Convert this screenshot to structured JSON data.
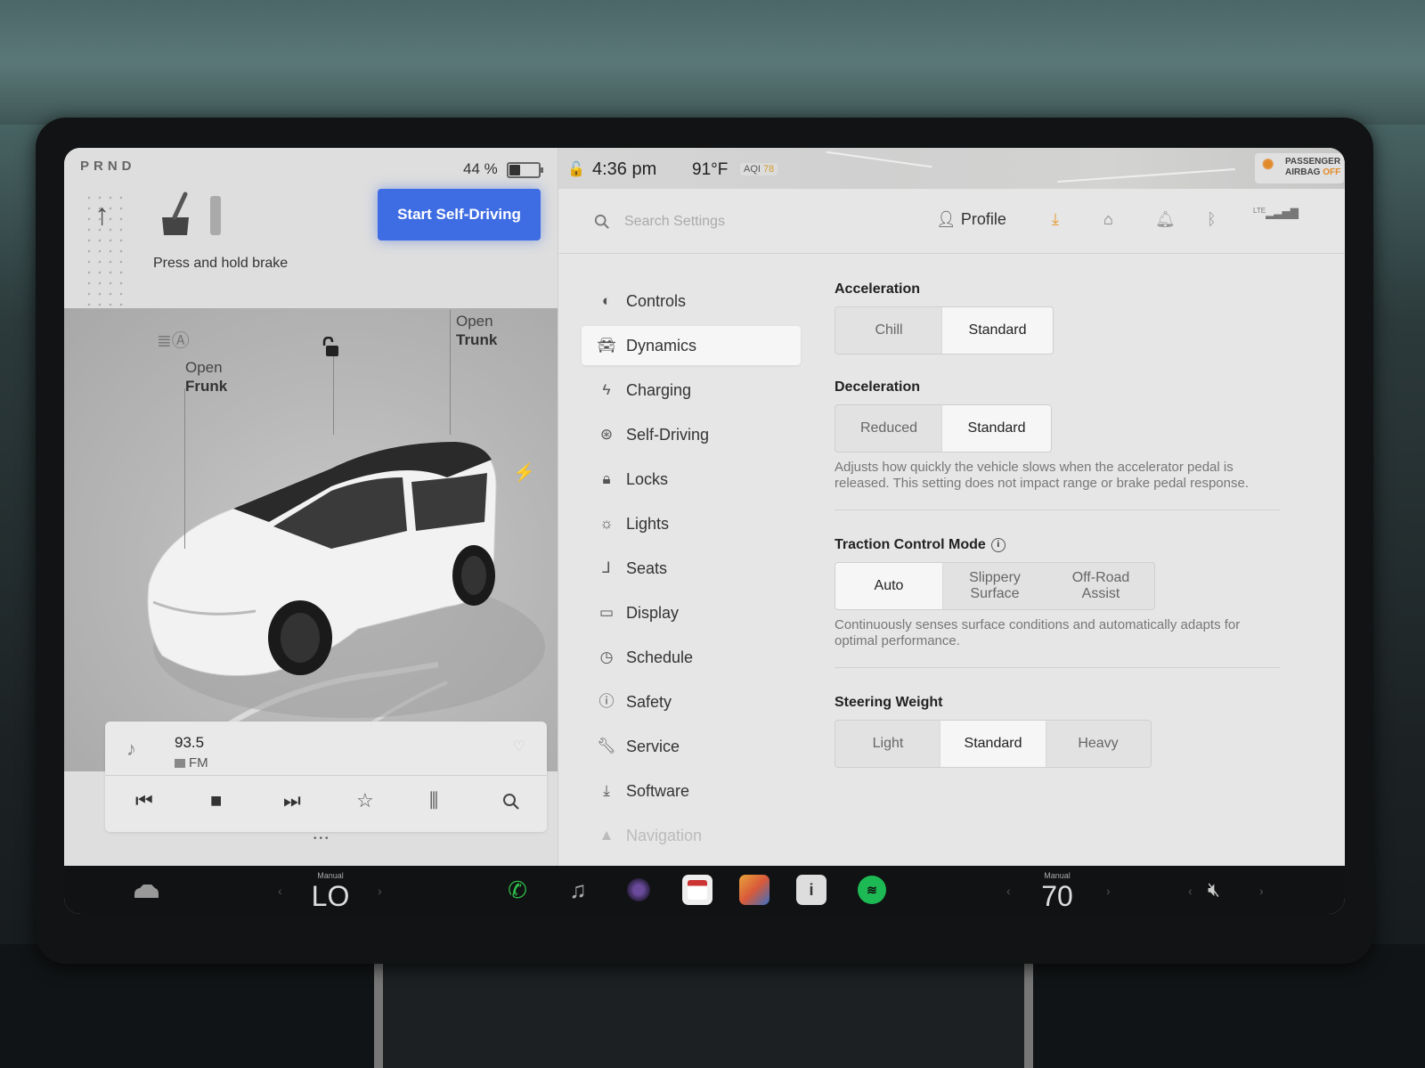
{
  "left_panel": {
    "gear": "PRND",
    "battery_percent": "44 %",
    "battery_level": 0.44,
    "brake_prompt": "Press and hold brake",
    "self_driving_button": "Start Self-Driving",
    "frunk_label_top": "Open",
    "frunk_label_bottom": "Frunk",
    "trunk_label_top": "Open",
    "trunk_label_bottom": "Trunk"
  },
  "media": {
    "station": "93.5",
    "band": "FM",
    "controls": [
      "previous-icon",
      "stop-icon",
      "next-icon",
      "star-icon",
      "equalizer-icon",
      "search-icon"
    ]
  },
  "status_bar": {
    "time": "4:36 pm",
    "temperature": "91°F",
    "aqi_label": "AQI",
    "aqi_value": "78",
    "airbag_line1": "PASSENGER",
    "airbag_line2": "AIRBAG",
    "airbag_state": "OFF"
  },
  "topbar": {
    "search_placeholder": "Search Settings",
    "profile_label": "Profile",
    "lte_label": "LTE"
  },
  "nav": {
    "items": [
      {
        "label": "Controls",
        "icon": "toggle-icon"
      },
      {
        "label": "Dynamics",
        "icon": "car-icon"
      },
      {
        "label": "Charging",
        "icon": "bolt-icon"
      },
      {
        "label": "Self-Driving",
        "icon": "steering-wheel-icon"
      },
      {
        "label": "Locks",
        "icon": "lock-icon"
      },
      {
        "label": "Lights",
        "icon": "sun-icon"
      },
      {
        "label": "Seats",
        "icon": "seat-icon"
      },
      {
        "label": "Display",
        "icon": "display-icon"
      },
      {
        "label": "Schedule",
        "icon": "clock-icon"
      },
      {
        "label": "Safety",
        "icon": "alert-icon"
      },
      {
        "label": "Service",
        "icon": "wrench-icon"
      },
      {
        "label": "Software",
        "icon": "download-icon"
      },
      {
        "label": "Navigation",
        "icon": "navigation-icon"
      }
    ]
  },
  "settings": {
    "acceleration": {
      "title": "Acceleration",
      "options": [
        "Chill",
        "Standard"
      ],
      "selected": "Standard"
    },
    "deceleration": {
      "title": "Deceleration",
      "options": [
        "Reduced",
        "Standard"
      ],
      "selected": "Standard",
      "description": "Adjusts how quickly the vehicle slows when the accelerator pedal is released. This setting does not impact range or brake pedal response."
    },
    "traction": {
      "title": "Traction Control Mode",
      "options": [
        "Auto",
        "Slippery Surface",
        "Off-Road Assist"
      ],
      "selected": "Auto",
      "description": "Continuously senses surface conditions and automatically adapts for optimal performance."
    },
    "steering": {
      "title": "Steering Weight",
      "options": [
        "Light",
        "Standard",
        "Heavy"
      ],
      "selected": "Standard"
    }
  },
  "dock": {
    "left_climate_label": "Manual",
    "left_climate_value": "LO",
    "right_climate_label": "Manual",
    "right_climate_value": "70",
    "apps": [
      "phone-icon",
      "music-icon",
      "camera-icon",
      "calendar-icon",
      "toybox-icon",
      "manual-icon",
      "spotify-icon"
    ]
  }
}
